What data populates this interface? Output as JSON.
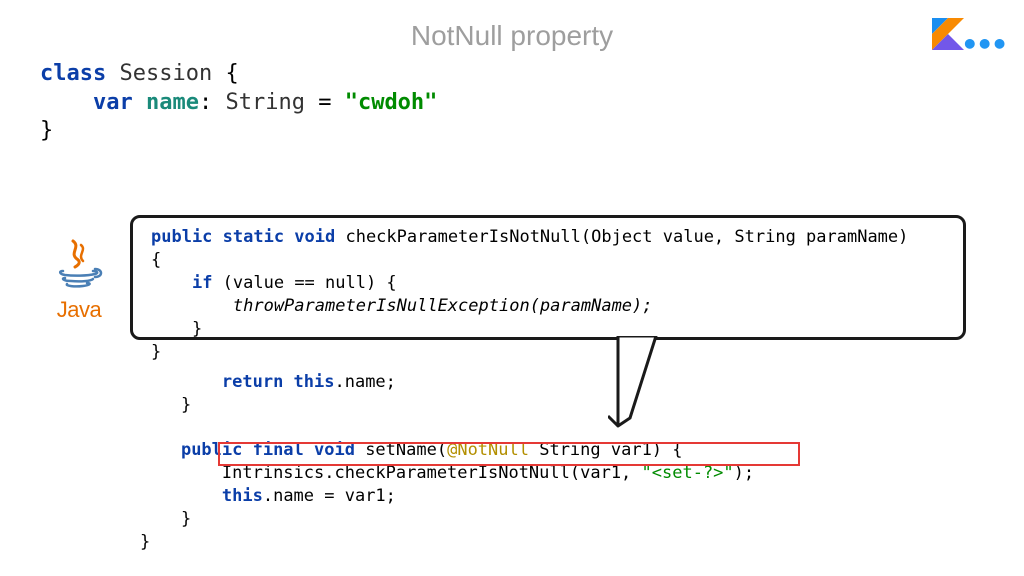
{
  "title": "NotNull property",
  "topCode": {
    "l1_kw1": "class",
    "l1_name": "Session",
    "l1_brace": " {",
    "l2_indent": "    ",
    "l2_kw1": "var",
    "l2_name": "name",
    "l2_colon": ": ",
    "l2_type": "String",
    "l2_eq": " = ",
    "l2_str": "\"cwdoh\"",
    "l3": "}"
  },
  "callout": {
    "l1_kw": "public static void",
    "l1_name": " checkParameterIsNotNull",
    "l1_rest": "(Object value, String paramName)",
    "l2": "{",
    "l3_pre": "    ",
    "l3_kw": "if",
    "l3_rest": " (value == null) {",
    "l4": "        throwParameterIsNullException(paramName);",
    "l5": "    }",
    "l6": "}"
  },
  "mainCode": {
    "blank_indent": "   ",
    "ret_pre": "        ",
    "ret_kw": "return this",
    "ret_rest": ".name;",
    "close1": "    }",
    "blank2": "",
    "m2_pre": "    ",
    "m2_kw": "public final void",
    "m2_name": " setName",
    "m2_p1": "(",
    "m2_ann": "@NotNull",
    "m2_rest": " String var1) {",
    "m3_pre": "        ",
    "m3_call": "Intrinsics.checkParameterIsNotNull(var1, ",
    "m3_str": "\"<set-?>\"",
    "m3_end": ");",
    "m4_pre": "        ",
    "m4_kw": "this",
    "m4_rest": ".name = var1;",
    "m5": "    }",
    "m6": "}"
  },
  "dots": "•••",
  "javaWord": "Java"
}
